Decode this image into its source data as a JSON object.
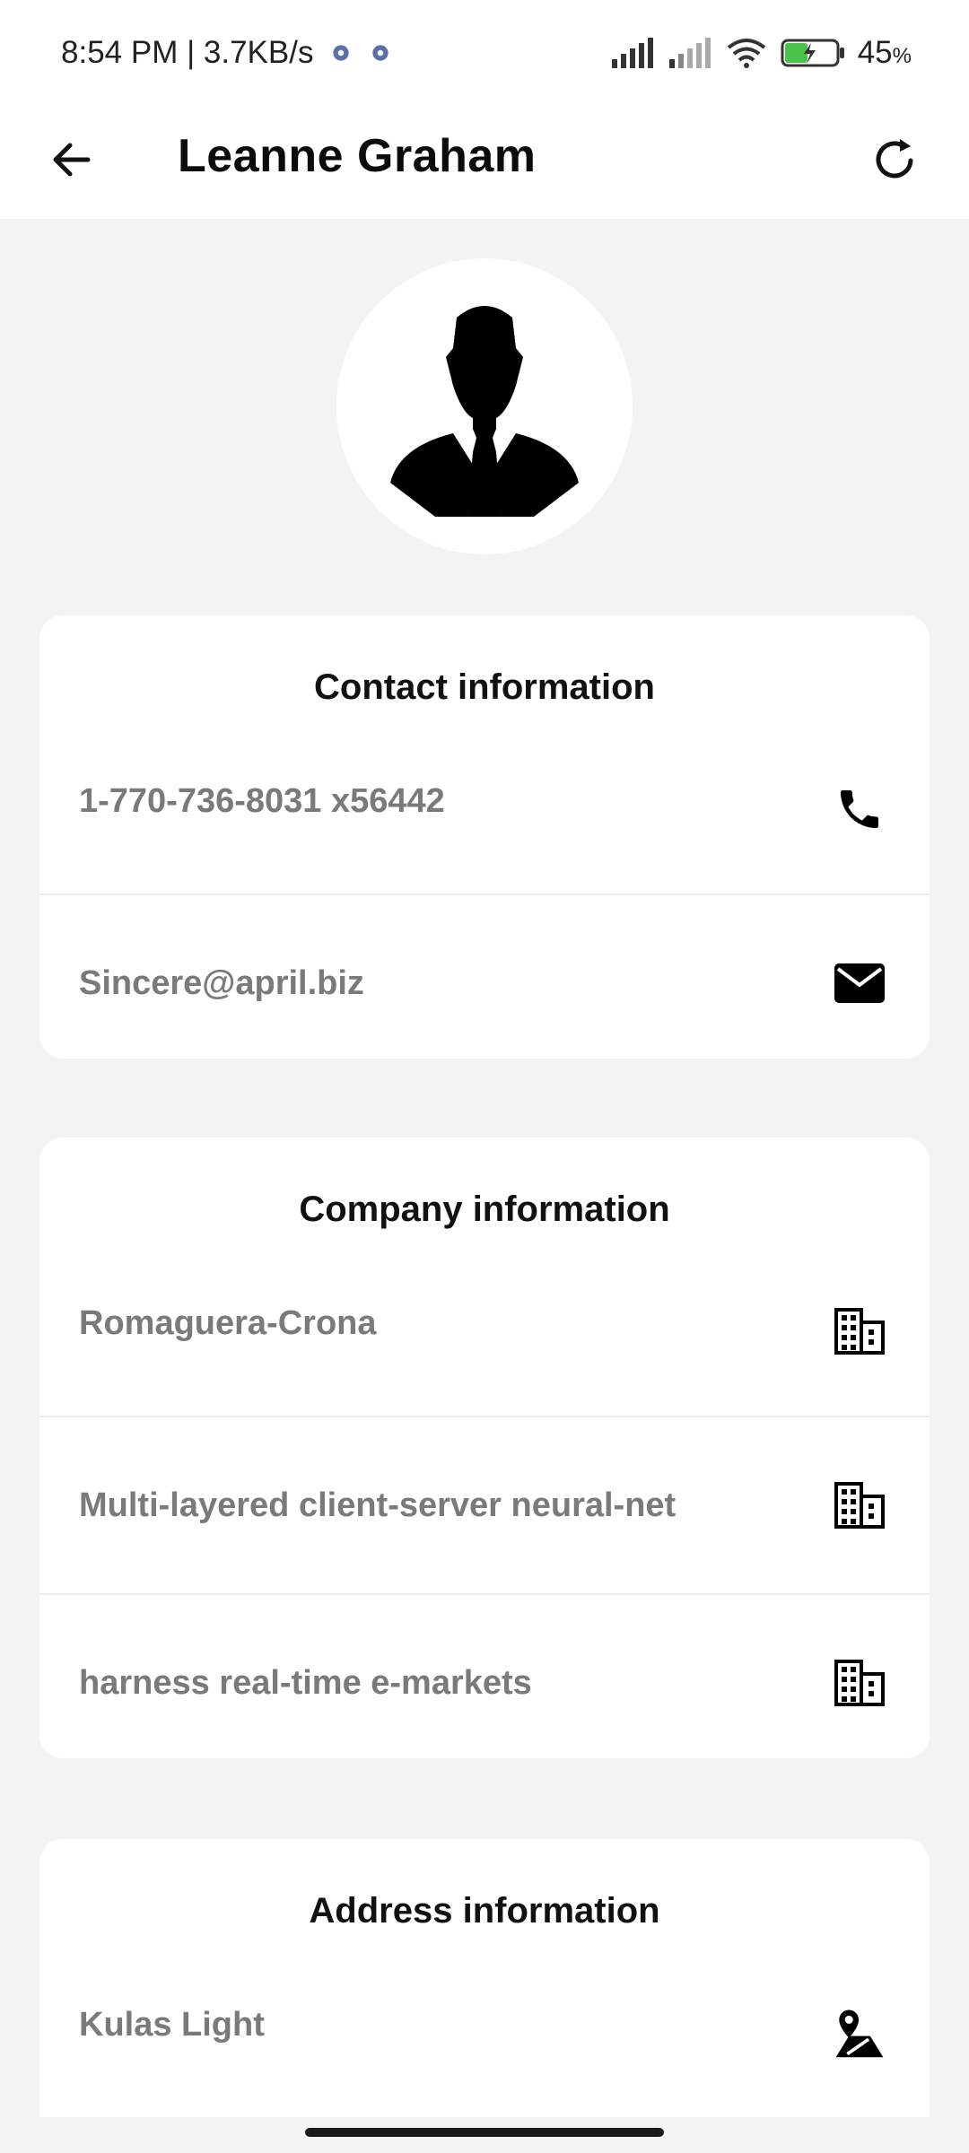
{
  "status_bar": {
    "time_speed": "8:54 PM | 3.7KB/s",
    "battery_level": "45",
    "battery_unit": "%"
  },
  "app_bar": {
    "title": "Leanne Graham"
  },
  "contact": {
    "title": "Contact information",
    "phone": "1-770-736-8031 x56442",
    "email": "Sincere@april.biz"
  },
  "company": {
    "title": "Company information",
    "name": "Romaguera-Crona",
    "catch_phrase": "Multi-layered client-server neural-net",
    "bs": "harness real-time e-markets"
  },
  "address": {
    "title": "Address information",
    "street": "Kulas Light"
  },
  "icons": {
    "back": "arrow-left-icon",
    "refresh": "refresh-icon",
    "phone": "phone-icon",
    "email": "mail-icon",
    "company": "building-icon",
    "address": "map-pin-icon"
  }
}
